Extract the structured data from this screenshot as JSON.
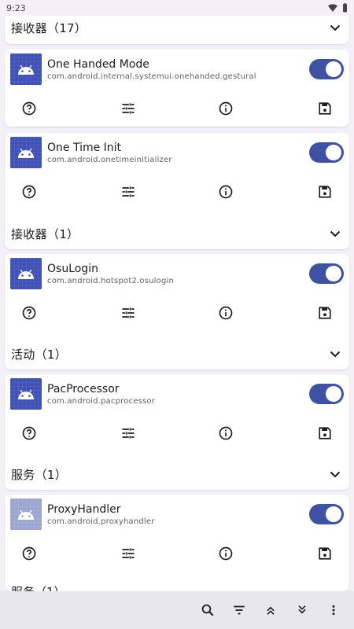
{
  "status_bar": {
    "time": "9:23"
  },
  "groups": [
    {
      "header": "接收器（17）"
    },
    {
      "header": "接收器（1）"
    },
    {
      "header": "活动（1）"
    },
    {
      "header": "服务（1）"
    }
  ],
  "components": [
    {
      "name": "One Handed Mode",
      "package": "com.android.internal.systemui.onehanded.gestural",
      "enabled": true
    },
    {
      "name": "One Time Init",
      "package": "com.android.onetimeinitializer",
      "enabled": true
    },
    {
      "name": "OsuLogin",
      "package": "com.android.hotspot2.osulogin",
      "enabled": true
    },
    {
      "name": "PacProcessor",
      "package": "com.android.pacprocessor",
      "enabled": true
    },
    {
      "name": "ProxyHandler",
      "package": "com.android.proxyhandler",
      "enabled": true
    }
  ],
  "peek_text": "服务（1）",
  "colors": {
    "accent": "#3f51a3",
    "icon_bg": "#3f51b5",
    "background": "#f3f1f7"
  },
  "icons": {
    "action1": "help-circle-icon",
    "action2": "tune-icon",
    "action3": "info-icon",
    "action4": "save-icon",
    "toolbar": [
      "search-icon",
      "filter-icon",
      "collapse-all-icon",
      "expand-all-icon",
      "more-vert-icon"
    ]
  }
}
